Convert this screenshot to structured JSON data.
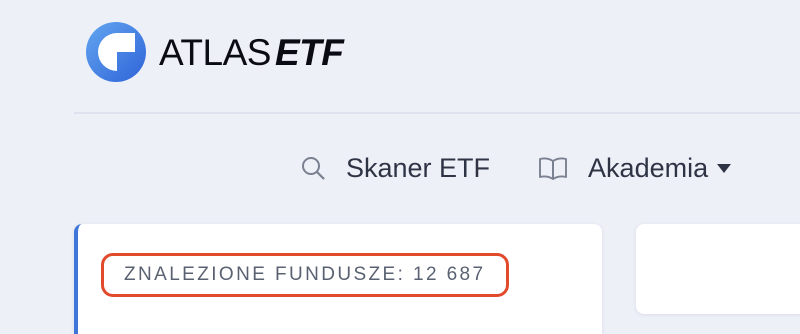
{
  "brand": {
    "name_part1": "ATLAS",
    "name_part2": "ETF",
    "logo_colors": [
      "#63a6f0",
      "#2f63d8"
    ],
    "text_color": "#0b0b14"
  },
  "nav": {
    "items": [
      {
        "label": "Skaner ETF",
        "icon": "search-icon"
      },
      {
        "label": "Akademia",
        "icon": "book-icon",
        "has_dropdown": true
      }
    ]
  },
  "results": {
    "found_label": "ZNALEZIONE FUNDUSZE: 12 687"
  },
  "colors": {
    "background": "#eef0f8",
    "card_accent": "#3d76d8",
    "highlight_outline": "#e24a2c",
    "nav_text": "#2f3445",
    "muted_text": "#5a6272"
  }
}
